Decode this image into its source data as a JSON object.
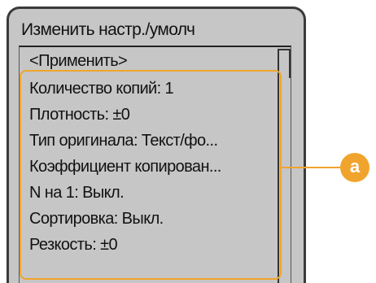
{
  "screen": {
    "title": "Изменить настр./умолч"
  },
  "menu": {
    "items": [
      {
        "label": "<Применить>"
      },
      {
        "label": "Количество копий:  1"
      },
      {
        "label": "Плотность: ±0"
      },
      {
        "label": "Тип оригинала: Текст/фо..."
      },
      {
        "label": "Коэффициент копирован..."
      },
      {
        "label": "N на 1: Выкл."
      },
      {
        "label": "Сортировка: Выкл."
      },
      {
        "label": "Резкость: ±0"
      }
    ]
  },
  "callout": {
    "label": "a",
    "color": "#f0a42d"
  }
}
